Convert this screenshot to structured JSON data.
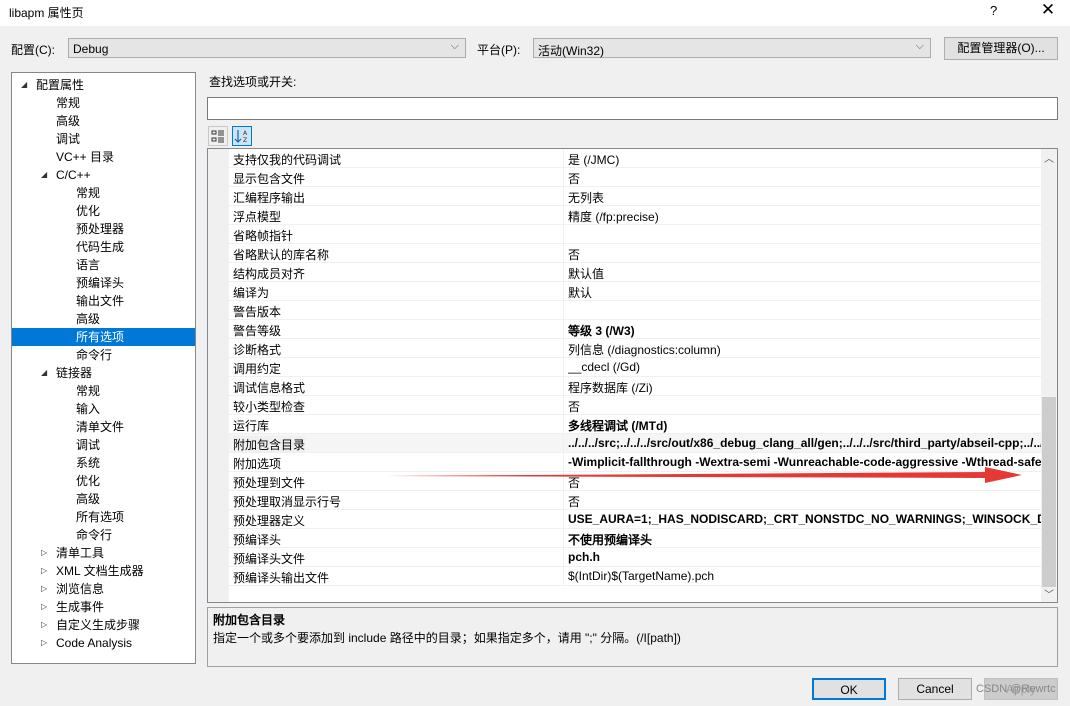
{
  "window": {
    "title": "libapm 属性页",
    "help_label": "?",
    "close_label": "✕"
  },
  "config": {
    "config_label": "配置(C):",
    "config_value": "Debug",
    "platform_label": "平台(P):",
    "platform_value": "活动(Win32)",
    "manager_button": "配置管理器(O)..."
  },
  "tree": {
    "items": [
      {
        "label": "配置属性",
        "level": 0,
        "expander": "expanded"
      },
      {
        "label": "常规",
        "level": 1,
        "expander": "none"
      },
      {
        "label": "高级",
        "level": 1,
        "expander": "none"
      },
      {
        "label": "调试",
        "level": 1,
        "expander": "none"
      },
      {
        "label": "VC++ 目录",
        "level": 1,
        "expander": "none"
      },
      {
        "label": "C/C++",
        "level": 1,
        "expander": "expanded"
      },
      {
        "label": "常规",
        "level": 2,
        "expander": "none"
      },
      {
        "label": "优化",
        "level": 2,
        "expander": "none"
      },
      {
        "label": "预处理器",
        "level": 2,
        "expander": "none"
      },
      {
        "label": "代码生成",
        "level": 2,
        "expander": "none"
      },
      {
        "label": "语言",
        "level": 2,
        "expander": "none"
      },
      {
        "label": "预编译头",
        "level": 2,
        "expander": "none"
      },
      {
        "label": "输出文件",
        "level": 2,
        "expander": "none"
      },
      {
        "label": "高级",
        "level": 2,
        "expander": "none"
      },
      {
        "label": "所有选项",
        "level": 2,
        "expander": "none",
        "selected": true
      },
      {
        "label": "命令行",
        "level": 2,
        "expander": "none"
      },
      {
        "label": "链接器",
        "level": 1,
        "expander": "expanded"
      },
      {
        "label": "常规",
        "level": 2,
        "expander": "none"
      },
      {
        "label": "输入",
        "level": 2,
        "expander": "none"
      },
      {
        "label": "清单文件",
        "level": 2,
        "expander": "none"
      },
      {
        "label": "调试",
        "level": 2,
        "expander": "none"
      },
      {
        "label": "系统",
        "level": 2,
        "expander": "none"
      },
      {
        "label": "优化",
        "level": 2,
        "expander": "none"
      },
      {
        "label": "高级",
        "level": 2,
        "expander": "none"
      },
      {
        "label": "所有选项",
        "level": 2,
        "expander": "none"
      },
      {
        "label": "命令行",
        "level": 2,
        "expander": "none"
      },
      {
        "label": "清单工具",
        "level": 1,
        "expander": "collapsed"
      },
      {
        "label": "XML 文档生成器",
        "level": 1,
        "expander": "collapsed"
      },
      {
        "label": "浏览信息",
        "level": 1,
        "expander": "collapsed"
      },
      {
        "label": "生成事件",
        "level": 1,
        "expander": "collapsed"
      },
      {
        "label": "自定义生成步骤",
        "level": 1,
        "expander": "collapsed"
      },
      {
        "label": "Code Analysis",
        "level": 1,
        "expander": "collapsed"
      }
    ]
  },
  "search": {
    "label": "查找选项或开关:",
    "value": "",
    "placeholder": ""
  },
  "toolbar": {
    "categorized_icon": "categorized-view-icon",
    "alphabetical_icon": "sort-alphabetical-icon"
  },
  "properties": [
    {
      "name": "支持仅我的代码调试",
      "value": "是 (/JMC)",
      "bold": false
    },
    {
      "name": "显示包含文件",
      "value": "否",
      "bold": false
    },
    {
      "name": "汇编程序输出",
      "value": "无列表",
      "bold": false
    },
    {
      "name": "浮点模型",
      "value": "精度 (/fp:precise)",
      "bold": false
    },
    {
      "name": "省略帧指针",
      "value": "",
      "bold": false
    },
    {
      "name": "省略默认的库名称",
      "value": "否",
      "bold": false
    },
    {
      "name": "结构成员对齐",
      "value": "默认值",
      "bold": false
    },
    {
      "name": "编译为",
      "value": "默认",
      "bold": false
    },
    {
      "name": "警告版本",
      "value": "",
      "bold": false
    },
    {
      "name": "警告等级",
      "value": "等级 3 (/W3)",
      "bold": true
    },
    {
      "name": "诊断格式",
      "value": "列信息 (/diagnostics:column)",
      "bold": false
    },
    {
      "name": "调用约定",
      "value": "__cdecl (/Gd)",
      "bold": false
    },
    {
      "name": "调试信息格式",
      "value": "程序数据库 (/Zi)",
      "bold": false
    },
    {
      "name": "较小类型检查",
      "value": "否",
      "bold": false
    },
    {
      "name": "运行库",
      "value": "多线程调试 (/MTd)",
      "bold": true
    },
    {
      "name": "附加包含目录",
      "value": "../../../src;../../../src/out/x86_debug_clang_all/gen;../../../src/third_party/abseil-cpp;../../..",
      "bold": true,
      "highlighted": true
    },
    {
      "name": "附加选项",
      "value": "-Wimplicit-fallthrough -Wextra-semi -Wunreachable-code-aggressive -Wthread-safety",
      "bold": true
    },
    {
      "name": "预处理到文件",
      "value": "否",
      "bold": false
    },
    {
      "name": "预处理取消显示行号",
      "value": "否",
      "bold": false
    },
    {
      "name": "预处理器定义",
      "value": "USE_AURA=1;_HAS_NODISCARD;_CRT_NONSTDC_NO_WARNINGS;_WINSOCK_DEPRECATED",
      "bold": true
    },
    {
      "name": "预编译头",
      "value": "不使用预编译头",
      "bold": true
    },
    {
      "name": "预编译头文件",
      "value": "pch.h",
      "bold": true
    },
    {
      "name": "预编译头输出文件",
      "value": "$(IntDir)$(TargetName).pch",
      "bold": false
    }
  ],
  "description": {
    "title": "附加包含目录",
    "text": "指定一个或多个要添加到 include 路径中的目录；如果指定多个，请用 \";\" 分隔。(/I[path])"
  },
  "buttons": {
    "ok": "OK",
    "cancel": "Cancel",
    "apply": "Apply"
  },
  "annotation": {
    "arrow_color": "#e53935"
  },
  "watermark": "CSDN @Rewrtc"
}
